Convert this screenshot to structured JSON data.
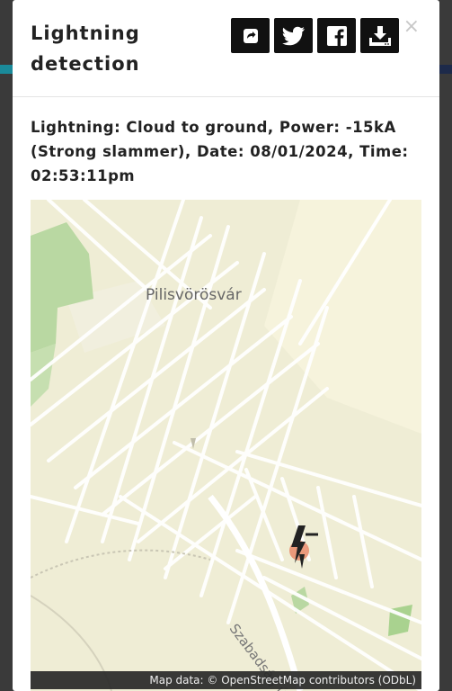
{
  "modal": {
    "title": "Lightning detection",
    "close_label": "×",
    "actions": [
      {
        "icon": "share-icon"
      },
      {
        "icon": "twitter-icon"
      },
      {
        "icon": "facebook-icon"
      },
      {
        "icon": "download-icon"
      }
    ]
  },
  "lightning": {
    "description": "Lightning: Cloud to ground, Power: -15kA (Strong slammer), Date: 08/01/2024, Time: 02:53:11pm"
  },
  "map": {
    "town_label": "Pilisvörösvár",
    "street_label": "Szabadság ú",
    "attribution": "Map data: © OpenStreetMap contributors (ODbL)",
    "marker_icon": "lightning-strike-icon"
  },
  "colors": {
    "accent_teal": "#1a8a9a",
    "action_button": "#111111",
    "map_background": "#efedd5",
    "forest": "#b9d8a2",
    "marker": "#e07050"
  }
}
